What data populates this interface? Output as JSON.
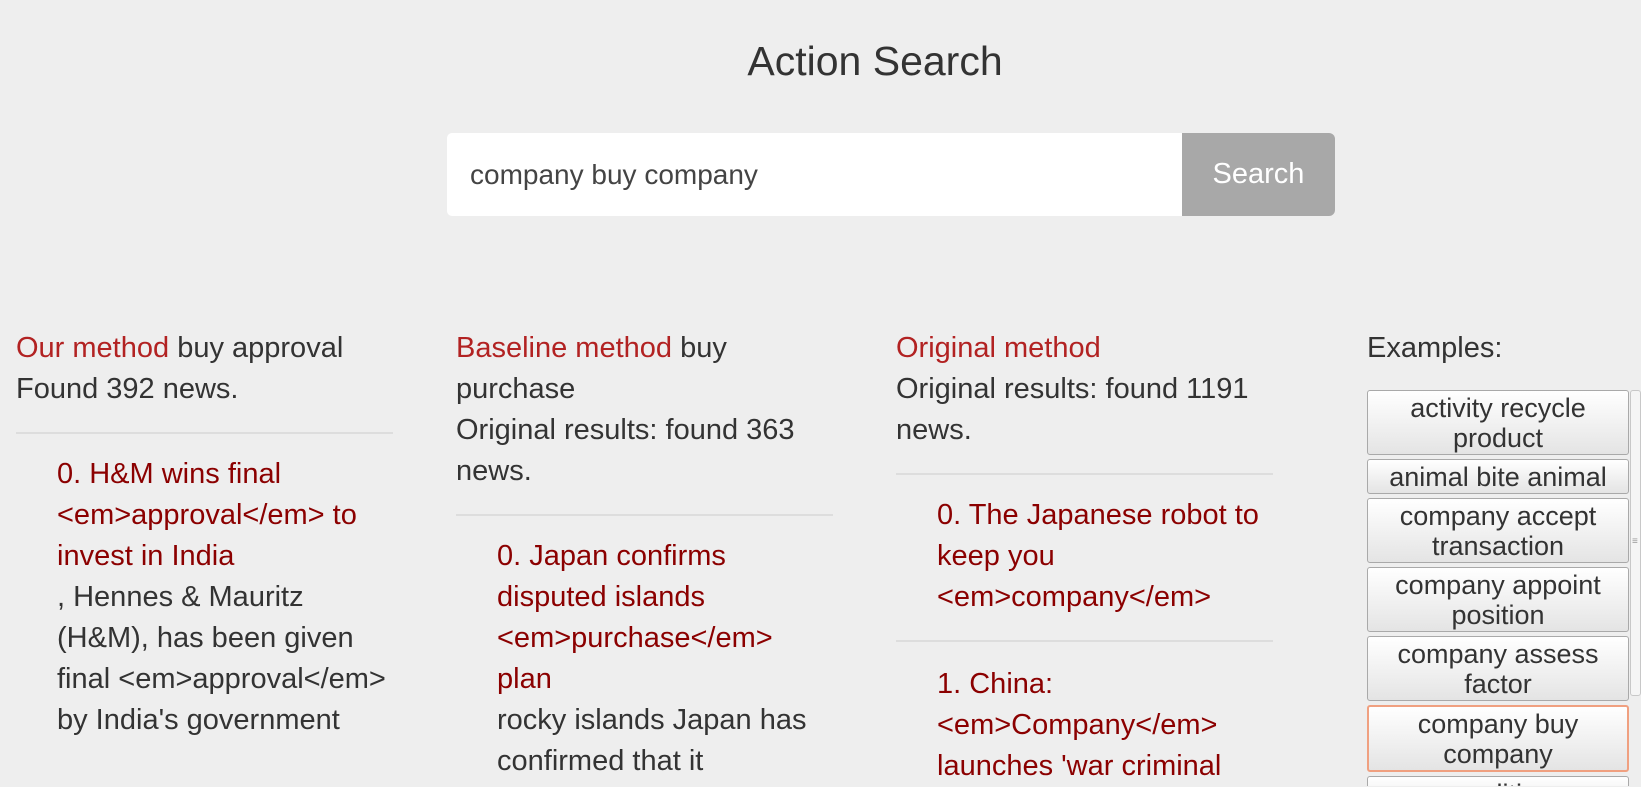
{
  "title": "Action Search",
  "search": {
    "value": "company buy company",
    "button_label": "Search"
  },
  "columns": {
    "ours": {
      "method_label": "Our method",
      "method_action": "buy approval",
      "summary": "Found 392 news.",
      "results": [
        {
          "title": "0. H&M wins final <em>approval</em> to invest in India",
          "body": ", Hennes & Mauritz (H&M), has been given final <em>approval</em> by India's government"
        }
      ]
    },
    "baseline": {
      "method_label": "Baseline method",
      "method_action": "buy purchase",
      "summary": "Original results: found 363 news.",
      "results": [
        {
          "title": "0. Japan confirms disputed islands <em>purchase</em> plan",
          "body": "rocky islands Japan has confirmed that it"
        }
      ]
    },
    "original": {
      "method_label": "Original method",
      "summary": "Original results: found 1191 news.",
      "results": [
        {
          "title": "0. The Japanese robot to keep you <em>company</em>"
        },
        {
          "title": "1. China: <em>Company</em> launches 'war criminal"
        }
      ]
    }
  },
  "examples": {
    "label": "Examples:",
    "items": [
      "activity recycle product",
      "animal bite animal",
      "company accept transaction",
      "company appoint position",
      "company assess factor",
      "company buy company",
      "condition"
    ],
    "selected": "company buy company"
  },
  "colors": {
    "background": "#eeeeee",
    "accent_red": "#b22222",
    "result_title": "#8b0000",
    "search_button": "#a8a8a8",
    "selected_border": "#f0a080"
  }
}
